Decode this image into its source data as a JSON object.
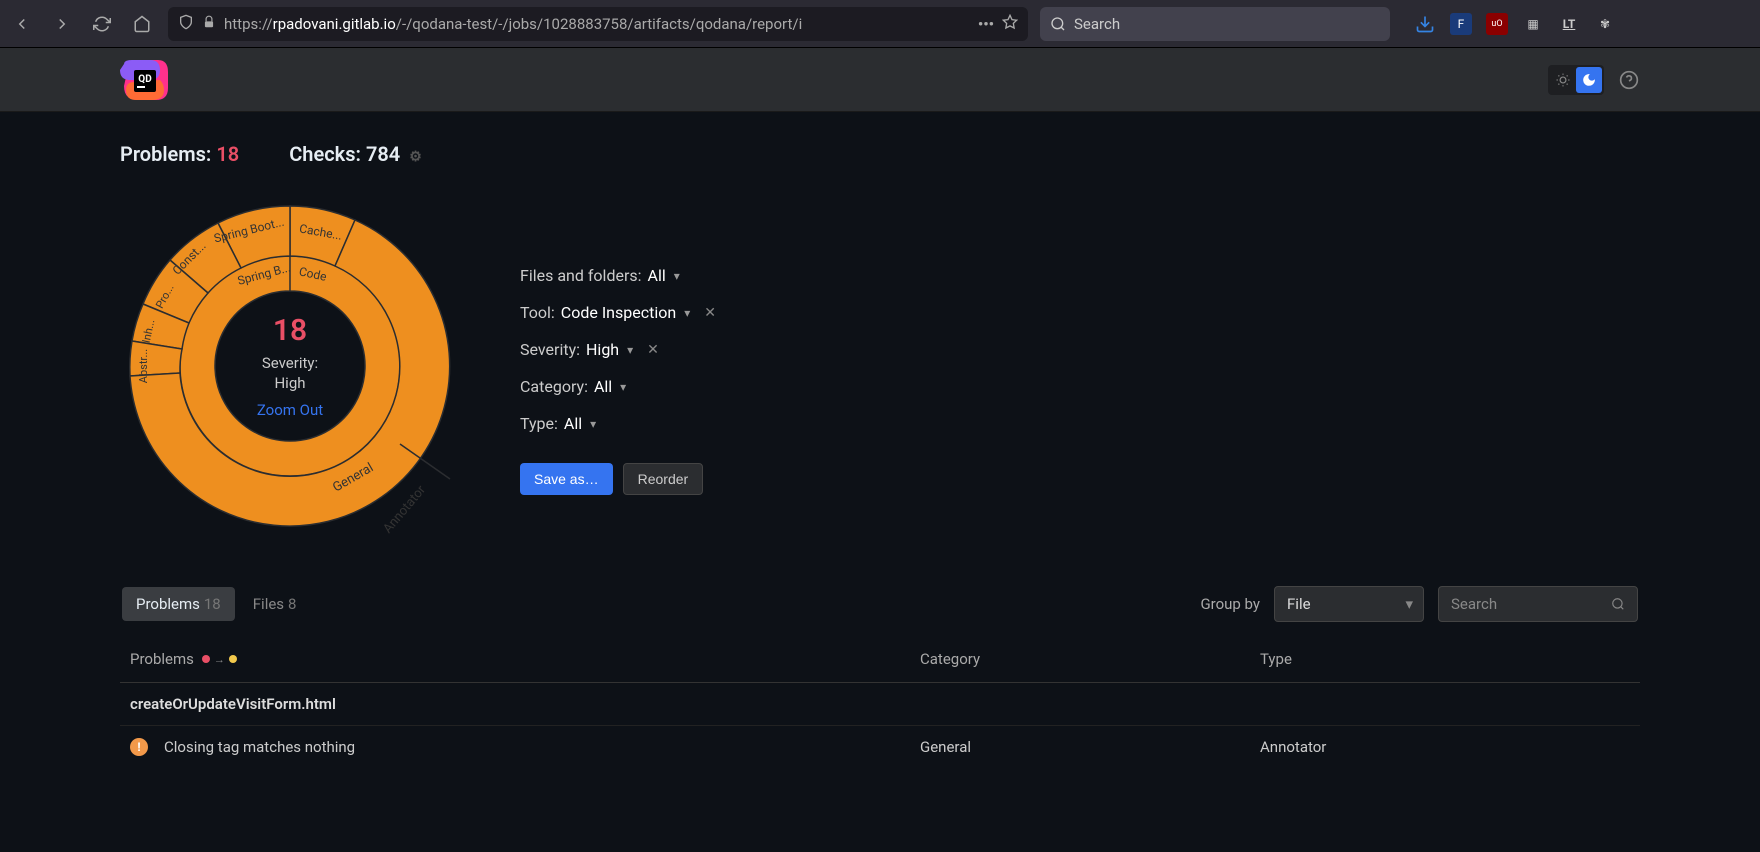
{
  "browser": {
    "url_prefix": "https://",
    "url_domain": "rpadovani.gitlab.io",
    "url_path": "/-/qodana-test/-/jobs/1028883758/artifacts/qodana/report/i",
    "search_placeholder": "Search"
  },
  "stats": {
    "problems_label": "Problems:",
    "problems_count": "18",
    "checks_label": "Checks:",
    "checks_count": "784"
  },
  "sunburst_center": {
    "count": "18",
    "severity_label": "Severity:",
    "severity_value": "High",
    "zoom_out": "Zoom Out"
  },
  "chart_data": {
    "type": "sunburst",
    "title": "",
    "inner_ring": [
      {
        "name": "Code",
        "value": 18,
        "children": [
          "Spring B...",
          "Cache...",
          "Spring Boot...",
          "Const...",
          "Pro...",
          "Abstr...",
          "Inh...",
          "General",
          "Annotator"
        ]
      }
    ],
    "outer_labels": [
      "Cache...",
      "Spring Boot...",
      "Spring B...",
      "Const...",
      "Pro...",
      "Inh...",
      "Abstr...",
      "General",
      "Annotator"
    ],
    "color": "#ee8f1f"
  },
  "filters": {
    "files": {
      "label": "Files and folders:",
      "value": "All"
    },
    "tool": {
      "label": "Tool:",
      "value": "Code Inspection"
    },
    "severity": {
      "label": "Severity:",
      "value": "High"
    },
    "category": {
      "label": "Category:",
      "value": "All"
    },
    "type": {
      "label": "Type:",
      "value": "All"
    },
    "save_as": "Save as…",
    "reorder": "Reorder"
  },
  "tabs": {
    "problems_label": "Problems",
    "problems_count": "18",
    "files_label": "Files",
    "files_count": "8"
  },
  "groupby": {
    "label": "Group by",
    "value": "File"
  },
  "search_placeholder": "Search",
  "table_headers": {
    "problems": "Problems",
    "category": "Category",
    "type": "Type"
  },
  "rows": {
    "file1": "createOrUpdateVisitForm.html",
    "p1_text": "Closing tag matches nothing",
    "p1_category": "General",
    "p1_type": "Annotator"
  }
}
